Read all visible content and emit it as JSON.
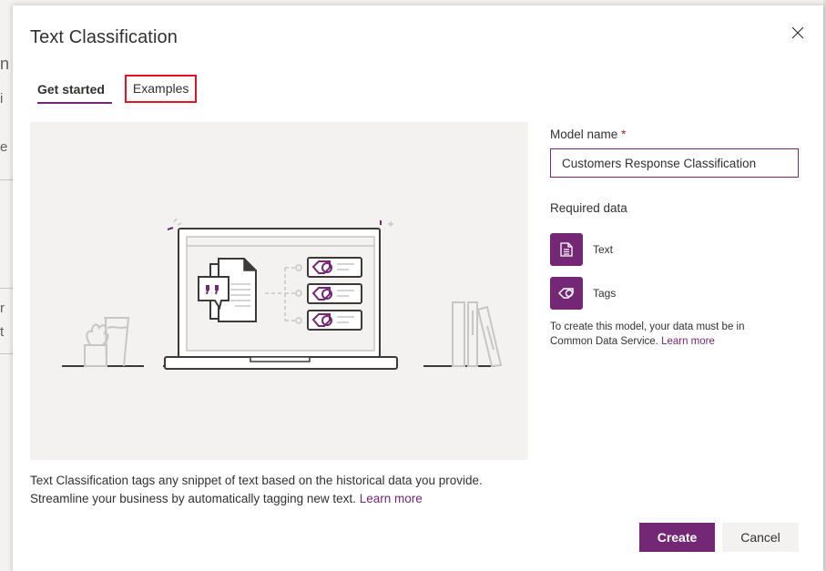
{
  "background": {
    "fragments": [
      "n",
      "i",
      "e",
      "r",
      "t"
    ]
  },
  "dialog": {
    "title": "Text Classification",
    "close_icon": "close-icon",
    "tabs": [
      {
        "label": "Get started",
        "active": true
      },
      {
        "label": "Examples",
        "active": false,
        "highlighted": true
      }
    ],
    "illustration": "laptop-text-classification-illustration",
    "description": {
      "text": "Text Classification tags any snippet of text based on the historical data you provide. Streamline your business by automatically tagging new text.",
      "link": "Learn more"
    },
    "model_name": {
      "label": "Model name",
      "required_marker": "*",
      "value": "Customers Response Classification"
    },
    "required_data": {
      "label": "Required data",
      "items": [
        {
          "icon": "document-icon",
          "label": "Text"
        },
        {
          "icon": "tag-icon",
          "label": "Tags"
        }
      ],
      "note": "To create this model, your data must be in Common Data Service.",
      "note_link": "Learn more"
    },
    "buttons": {
      "create": "Create",
      "cancel": "Cancel"
    }
  },
  "colors": {
    "accent": "#742774",
    "highlight_border": "#e81123",
    "hero_bg": "#f3f2f1"
  }
}
